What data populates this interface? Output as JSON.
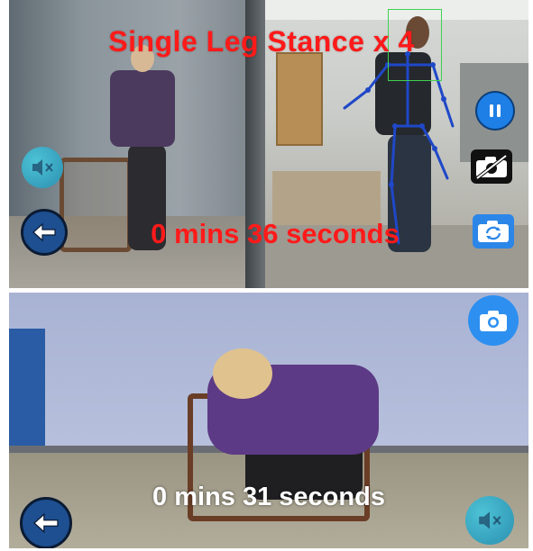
{
  "exercise": {
    "title": "Single Leg Stance x 4"
  },
  "timers": {
    "top": "0 mins 36 seconds",
    "bottom": "0 mins 31 seconds"
  },
  "controls": {
    "top_back": "back-arrow-icon",
    "top_mute": "speaker-muted-icon",
    "pause": "pause-icon",
    "camera_off": "camera-off-icon",
    "switch_camera": "switch-camera-icon",
    "bottom_camera": "camera-icon",
    "bottom_back": "back-arrow-icon",
    "bottom_mute": "speaker-muted-icon"
  },
  "colors": {
    "title_red": "#ff1a1a",
    "accent_blue": "#1e7fe6",
    "skeleton_blue": "#1f48c8",
    "bbox_green": "#3fd24f",
    "teal": "#3fb5cf"
  }
}
